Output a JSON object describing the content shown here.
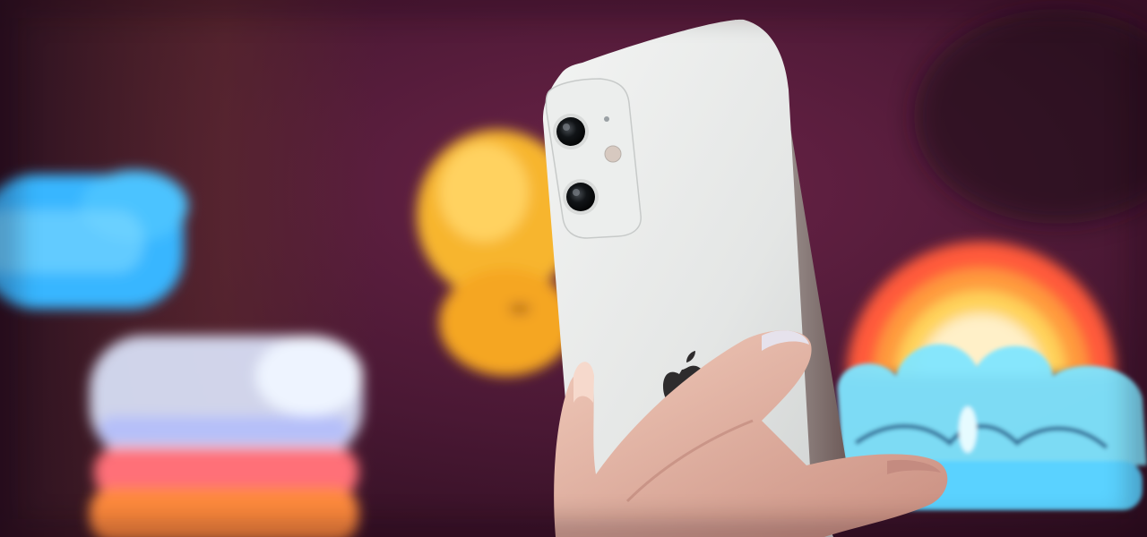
{
  "scene": {
    "description_tags": [
      "photo",
      "smartphone",
      "hand",
      "neon-lights",
      "bokeh"
    ],
    "colors": {
      "background_dark": "#2a0f1e",
      "background_mid": "#5a1f3a",
      "neon_blue": "#39b6ff",
      "neon_yellow": "#f7b52e",
      "neon_cyan": "#7fe6ff",
      "rainbow_red": "#ff5a3a",
      "rainbow_orange": "#ff9a3c",
      "rainbow_yellow": "#ffd35a",
      "phone_body": "#e9ebea",
      "skin": "#e8b8a6"
    }
  }
}
